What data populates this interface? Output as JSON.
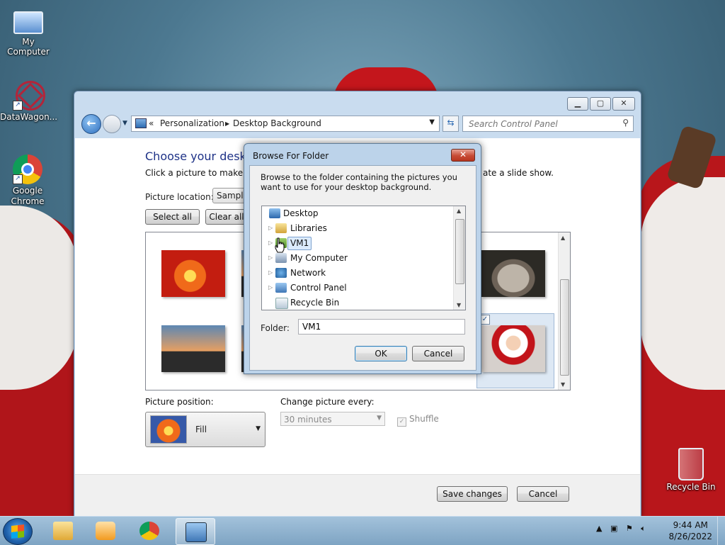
{
  "desktop": {
    "icons": [
      {
        "label": "My Computer"
      },
      {
        "label": "DataWagon..."
      },
      {
        "label": "Google Chrome"
      },
      {
        "label": "Recycle Bin"
      }
    ]
  },
  "window": {
    "address": {
      "overflow": "«",
      "crumbs": [
        "Personalization",
        "Desktop Background"
      ]
    },
    "search_placeholder": "Search Control Panel",
    "heading": "Choose your desktop",
    "instruction": "Click a picture to make it y",
    "instruction_tail": "ate a slide show.",
    "picture_location_label": "Picture location:",
    "picture_location_value": "Sample",
    "select_all": "Select all",
    "clear_all": "Clear all",
    "picture_position_label": "Picture position:",
    "picture_position_value": "Fill",
    "change_every_label": "Change picture every:",
    "change_every_value": "30 minutes",
    "shuffle_label": "Shuffle",
    "save_changes": "Save changes",
    "cancel": "Cancel"
  },
  "dialog": {
    "title": "Browse For Folder",
    "description": "Browse to the folder containing the pictures you want to use for your desktop background.",
    "tree": [
      {
        "label": "Desktop",
        "icon": "desktop-icon",
        "expandable": false,
        "selected": false
      },
      {
        "label": "Libraries",
        "icon": "libraries-icon",
        "expandable": true,
        "selected": false
      },
      {
        "label": "VM1",
        "icon": "user-folder-icon",
        "expandable": true,
        "selected": true
      },
      {
        "label": "My Computer",
        "icon": "computer-icon",
        "expandable": true,
        "selected": false
      },
      {
        "label": "Network",
        "icon": "network-icon",
        "expandable": true,
        "selected": false
      },
      {
        "label": "Control Panel",
        "icon": "control-panel-icon",
        "expandable": true,
        "selected": false
      },
      {
        "label": "Recycle Bin",
        "icon": "recycle-bin-icon",
        "expandable": false,
        "selected": false
      }
    ],
    "folder_label": "Folder:",
    "folder_value": "VM1",
    "ok": "OK",
    "cancel": "Cancel"
  },
  "taskbar": {
    "time": "9:44 AM",
    "date": "8/26/2022"
  }
}
